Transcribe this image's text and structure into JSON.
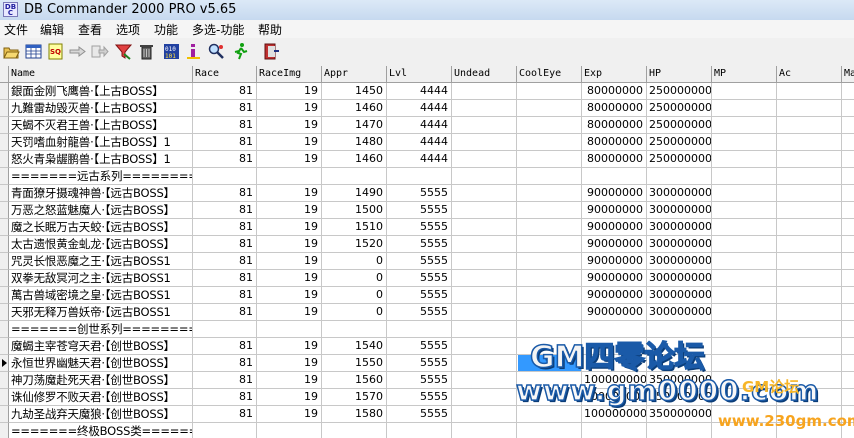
{
  "window": {
    "title": "DB Commander 2000 PRO v5.65"
  },
  "menu": [
    "文件",
    "编辑",
    "查看",
    "选项",
    "功能",
    "多选-功能",
    "帮助"
  ],
  "toolbar": [
    "open-folder-icon",
    "table-icon",
    "sql-icon",
    "arrow-right-icon",
    "export-icon",
    "filter-icon",
    "trash-icon",
    "binary-icon",
    "info-icon",
    "search-icon",
    "run-icon",
    "exit-icon"
  ],
  "columns": [
    "Name",
    "Race",
    "RaceImg",
    "Appr",
    "Lvl",
    "Undead",
    "CoolEye",
    "Exp",
    "HP",
    "MP",
    "Ac",
    "Ma"
  ],
  "rows": [
    [
      "銀面金刚飞鹰兽·【上古BOSS】",
      "81",
      "19",
      "1450",
      "4444",
      "",
      "",
      "80000000",
      "250000000",
      "",
      "",
      ""
    ],
    [
      "九難雷劫毁灭兽·【上古BOSS】",
      "81",
      "19",
      "1460",
      "4444",
      "",
      "",
      "80000000",
      "250000000",
      "",
      "",
      ""
    ],
    [
      "天蝎不灭君王兽·【上古BOSS】",
      "81",
      "19",
      "1470",
      "4444",
      "",
      "",
      "80000000",
      "250000000",
      "",
      "",
      ""
    ],
    [
      "天罚嗜血射龍兽·【上古BOSS】1",
      "81",
      "19",
      "1480",
      "4444",
      "",
      "",
      "80000000",
      "250000000",
      "",
      "",
      ""
    ],
    [
      "怒火青枭龌鹏兽·【上古BOSS】1",
      "81",
      "19",
      "1460",
      "4444",
      "",
      "",
      "80000000",
      "250000000",
      "",
      "",
      ""
    ],
    [
      "=======远古系列========",
      "",
      "",
      "",
      "",
      "",
      "",
      "",
      "",
      "",
      "",
      ""
    ],
    [
      "青面獠牙摄魂神兽·【远古BOSS】",
      "81",
      "19",
      "1490",
      "5555",
      "",
      "",
      "90000000",
      "300000000",
      "",
      "",
      ""
    ],
    [
      "万恶之怒蓝魅魔人·【远古BOSS】",
      "81",
      "19",
      "1500",
      "5555",
      "",
      "",
      "90000000",
      "300000000",
      "",
      "",
      ""
    ],
    [
      "魔之长眠万古天蛟·【远古BOSS】",
      "81",
      "19",
      "1510",
      "5555",
      "",
      "",
      "90000000",
      "300000000",
      "",
      "",
      ""
    ],
    [
      "太古遗恨黄金虬龙·【远古BOSS】",
      "81",
      "19",
      "1520",
      "5555",
      "",
      "",
      "90000000",
      "300000000",
      "",
      "",
      ""
    ],
    [
      "咒灵长恨恶魔之王·【远古BOSS1",
      "81",
      "19",
      "0",
      "5555",
      "",
      "",
      "90000000",
      "300000000",
      "",
      "",
      ""
    ],
    [
      "双拳无敌冥河之主·【远古BOSS1",
      "81",
      "19",
      "0",
      "5555",
      "",
      "",
      "90000000",
      "300000000",
      "",
      "",
      ""
    ],
    [
      "萬古兽域密境之皇·【远古BOSS1",
      "81",
      "19",
      "0",
      "5555",
      "",
      "",
      "90000000",
      "300000000",
      "",
      "",
      ""
    ],
    [
      "天邪无释万兽妖帝·【远古BOSS1",
      "81",
      "19",
      "0",
      "5555",
      "",
      "",
      "90000000",
      "300000000",
      "",
      "",
      ""
    ],
    [
      "=======创世系列========",
      "",
      "",
      "",
      "",
      "",
      "",
      "",
      "",
      "",
      "",
      ""
    ],
    [
      "魔蝎主宰苍穹天君·【创世BOSS】",
      "81",
      "19",
      "1540",
      "5555",
      "",
      "",
      "",
      "",
      "",
      "",
      ""
    ],
    [
      "永恒世界幽魅天君·【创世BOSS】",
      "81",
      "19",
      "1550",
      "5555",
      "",
      "",
      "",
      "",
      "",
      "",
      ""
    ],
    [
      "神刀荡魔赴死天君·【创世BOSS】",
      "81",
      "19",
      "1560",
      "5555",
      "",
      "",
      "100000000",
      "350000000",
      "",
      "",
      ""
    ],
    [
      "诛仙修罗不败天君·【创世BOSS】",
      "81",
      "19",
      "1570",
      "5555",
      "",
      "",
      "100000000",
      "350000000",
      "",
      "",
      ""
    ],
    [
      "九劫圣战弃天魔狼·【创世BOSS】",
      "81",
      "19",
      "1580",
      "5555",
      "",
      "",
      "100000000",
      "350000000",
      "",
      "",
      ""
    ],
    [
      "=======终极BOSS类========",
      "",
      "",
      "",
      "",
      "",
      "",
      "",
      "",
      "",
      "",
      ""
    ]
  ],
  "watermark": {
    "line1": "GM四零论坛",
    "line2": "www.gm0000.com",
    "line3": "GM论坛",
    "line4": "www.230gm.com"
  }
}
